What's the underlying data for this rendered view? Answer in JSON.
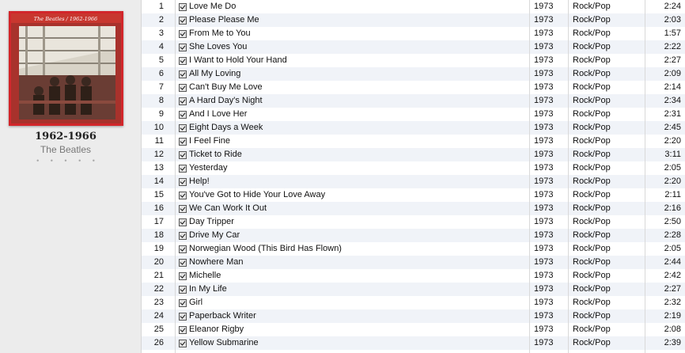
{
  "album": {
    "title": "1962-1966",
    "artist": "The Beatles",
    "cover_text": "The Beatles / 1962-1966",
    "rating": "• • • • •"
  },
  "colors": {
    "cover_border": "#d2262b",
    "row_alt": "#f0f3f8"
  },
  "tracks": [
    {
      "num": "1",
      "name": "Love Me Do",
      "year": "1973",
      "genre": "Rock/Pop",
      "time": "2:24"
    },
    {
      "num": "2",
      "name": "Please Please Me",
      "year": "1973",
      "genre": "Rock/Pop",
      "time": "2:03"
    },
    {
      "num": "3",
      "name": "From Me to You",
      "year": "1973",
      "genre": "Rock/Pop",
      "time": "1:57"
    },
    {
      "num": "4",
      "name": "She Loves You",
      "year": "1973",
      "genre": "Rock/Pop",
      "time": "2:22"
    },
    {
      "num": "5",
      "name": "I Want to Hold Your Hand",
      "year": "1973",
      "genre": "Rock/Pop",
      "time": "2:27"
    },
    {
      "num": "6",
      "name": "All My Loving",
      "year": "1973",
      "genre": "Rock/Pop",
      "time": "2:09"
    },
    {
      "num": "7",
      "name": "Can't Buy Me Love",
      "year": "1973",
      "genre": "Rock/Pop",
      "time": "2:14"
    },
    {
      "num": "8",
      "name": "A Hard Day's Night",
      "year": "1973",
      "genre": "Rock/Pop",
      "time": "2:34"
    },
    {
      "num": "9",
      "name": "And I Love Her",
      "year": "1973",
      "genre": "Rock/Pop",
      "time": "2:31"
    },
    {
      "num": "10",
      "name": "Eight Days a Week",
      "year": "1973",
      "genre": "Rock/Pop",
      "time": "2:45"
    },
    {
      "num": "11",
      "name": "I Feel Fine",
      "year": "1973",
      "genre": "Rock/Pop",
      "time": "2:20"
    },
    {
      "num": "12",
      "name": "Ticket to Ride",
      "year": "1973",
      "genre": "Rock/Pop",
      "time": "3:11"
    },
    {
      "num": "13",
      "name": "Yesterday",
      "year": "1973",
      "genre": "Rock/Pop",
      "time": "2:05"
    },
    {
      "num": "14",
      "name": "Help!",
      "year": "1973",
      "genre": "Rock/Pop",
      "time": "2:20"
    },
    {
      "num": "15",
      "name": "You've Got to Hide Your Love Away",
      "year": "1973",
      "genre": "Rock/Pop",
      "time": "2:11"
    },
    {
      "num": "16",
      "name": "We Can Work It Out",
      "year": "1973",
      "genre": "Rock/Pop",
      "time": "2:16"
    },
    {
      "num": "17",
      "name": "Day Tripper",
      "year": "1973",
      "genre": "Rock/Pop",
      "time": "2:50"
    },
    {
      "num": "18",
      "name": "Drive My Car",
      "year": "1973",
      "genre": "Rock/Pop",
      "time": "2:28"
    },
    {
      "num": "19",
      "name": "Norwegian Wood (This Bird Has Flown)",
      "year": "1973",
      "genre": "Rock/Pop",
      "time": "2:05"
    },
    {
      "num": "20",
      "name": "Nowhere Man",
      "year": "1973",
      "genre": "Rock/Pop",
      "time": "2:44"
    },
    {
      "num": "21",
      "name": "Michelle",
      "year": "1973",
      "genre": "Rock/Pop",
      "time": "2:42"
    },
    {
      "num": "22",
      "name": "In My Life",
      "year": "1973",
      "genre": "Rock/Pop",
      "time": "2:27"
    },
    {
      "num": "23",
      "name": "Girl",
      "year": "1973",
      "genre": "Rock/Pop",
      "time": "2:32"
    },
    {
      "num": "24",
      "name": "Paperback Writer",
      "year": "1973",
      "genre": "Rock/Pop",
      "time": "2:19"
    },
    {
      "num": "25",
      "name": "Eleanor Rigby",
      "year": "1973",
      "genre": "Rock/Pop",
      "time": "2:08"
    },
    {
      "num": "26",
      "name": "Yellow Submarine",
      "year": "1973",
      "genre": "Rock/Pop",
      "time": "2:39"
    }
  ]
}
